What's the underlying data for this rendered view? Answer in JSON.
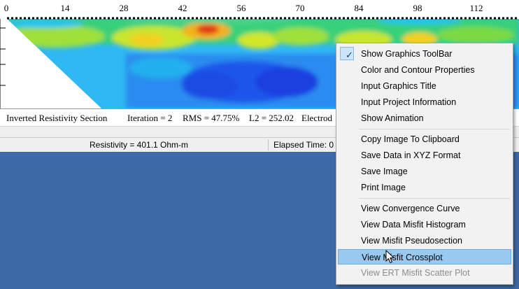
{
  "plot": {
    "x_ticks": [
      "0",
      "14",
      "28",
      "42",
      "56",
      "70",
      "84",
      "98",
      "112"
    ]
  },
  "info_bar": {
    "title": "Inverted Resistivity Section",
    "iteration": "Iteration = 2",
    "rms": "RMS = 47.75%",
    "l2": "L2 = 252.02",
    "electrode": "Electrod"
  },
  "status_bar": {
    "resistivity": "Resistivity = 401.1 Ohm-m",
    "elapsed": "Elapsed Time: 0"
  },
  "context_menu": {
    "items": [
      {
        "label": "Show Graphics ToolBar",
        "checked": true
      },
      {
        "label": "Color and Contour Properties"
      },
      {
        "label": "Input Graphics Title"
      },
      {
        "label": "Input Project Information"
      },
      {
        "label": "Show Animation"
      },
      {
        "label": "Copy Image To Clipboard"
      },
      {
        "label": "Save Data in XYZ Format"
      },
      {
        "label": "Save Image"
      },
      {
        "label": "Print Image"
      },
      {
        "label": "View Convergence Curve"
      },
      {
        "label": "View Data Misfit Histogram"
      },
      {
        "label": "View Misfit Pseudosection"
      },
      {
        "label": "View Misfit Crossplot",
        "highlighted": true
      },
      {
        "label": "View ERT Misfit Scatter Plot",
        "disabled": true
      }
    ]
  },
  "icons": {
    "check": "checkmark-icon",
    "cursor": "mouse-cursor-icon"
  },
  "colors": {
    "desktop": "#3d69a6",
    "menu_highlight": "#99c9ef",
    "resistivity_low": "#1f3fe0",
    "resistivity_mid": "#22c3ee",
    "resistivity_high": "#e23b12"
  }
}
